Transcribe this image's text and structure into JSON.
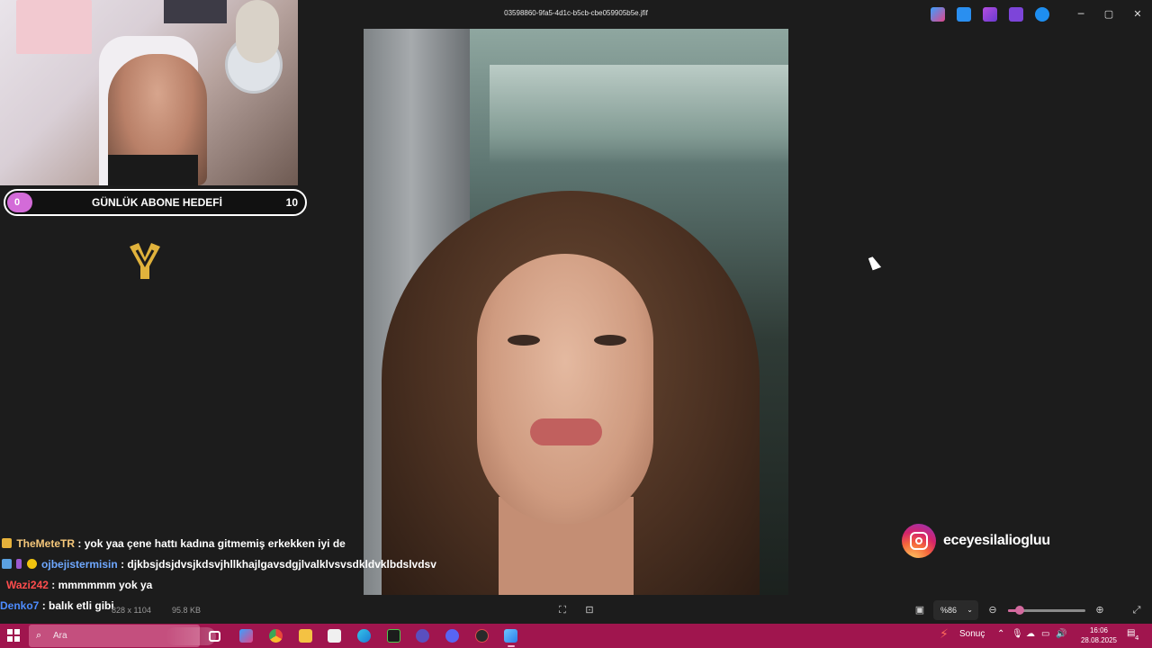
{
  "window": {
    "title": "03598860-9fa5-4d1c-b5cb-cbe059905b5e.jfif",
    "minimize_glyph": "─",
    "maximize_glyph": "▢",
    "close_glyph": "✕"
  },
  "overlay": {
    "goal": {
      "current": "0",
      "label": "GÜNLÜK ABONE HEDEFİ",
      "target": "10"
    },
    "instagram_handle": "eceyesilaliogluu"
  },
  "chat": [
    {
      "user": "TheMeteTR",
      "user_color": "#f5c77a",
      "text": ": yok yaa çene hattı kadına gitmemiş erkekken iyi de",
      "badges": [
        "#e7b23b"
      ]
    },
    {
      "user": "ojbejistermisin",
      "user_color": "#6fa8ff",
      "text": ": djkbsjdsjdvsjkdsvjhllkhajlgavsdgjlvalklvsvsdkldvklbdslvdsv",
      "badges": [
        "#5ba0e0",
        "#9b59d0",
        "#f1c40f"
      ]
    },
    {
      "user": "Wazi242",
      "user_color": "#ff4d4d",
      "text": ": mmmmmm yok ya",
      "badges": []
    },
    {
      "user": "Denko7",
      "user_color": "#4d8cff",
      "text": ": balık etli gibi",
      "badges": []
    }
  ],
  "viewer": {
    "dimensions": "828 x 1104",
    "file_size": "95.8 KB",
    "zoom": "%86",
    "zoom_level": 0.15,
    "icons": [
      "crop-icon",
      "enhance-icon",
      "fit-icon",
      "zoom-out-icon",
      "zoom-in-icon",
      "fullscreen-icon"
    ]
  },
  "taskbar": {
    "search_placeholder": "Ara",
    "weather": "Sonuç",
    "time": "16:06",
    "date": "28.08.2025",
    "notification_count": "4",
    "apps": [
      "task-view",
      "copilot",
      "chrome",
      "file-explorer",
      "store",
      "edge",
      "terminal",
      "obs",
      "discord",
      "app-dark",
      "photos"
    ],
    "accent": "#a0154e"
  },
  "accent_colors": {
    "goal_pill": "#d36bd8",
    "slider": "#d36a9e"
  }
}
